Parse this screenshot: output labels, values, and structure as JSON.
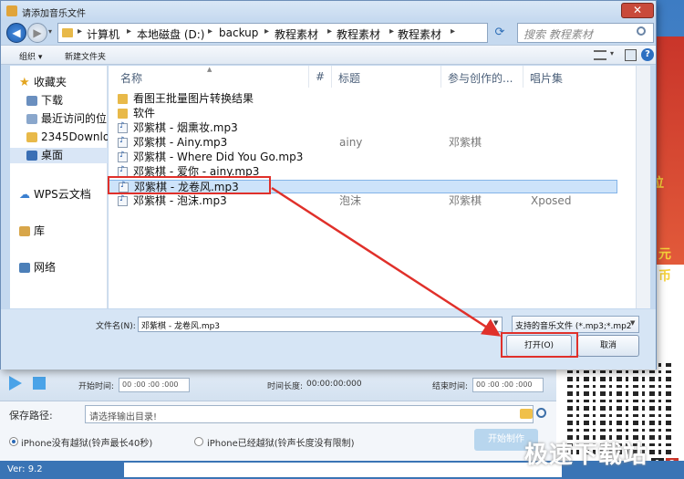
{
  "dialog": {
    "title": "请添加音乐文件",
    "close_label": "✕",
    "breadcrumbs": [
      "计算机",
      "本地磁盘 (D:)",
      "backup",
      "教程素材",
      "教程素材",
      "教程素材"
    ],
    "search_placeholder": "搜索 教程素材",
    "toolbar": {
      "organize": "组织 ▾",
      "new_folder": "新建文件夹"
    },
    "nav_pane": {
      "favorites": "收藏夹",
      "items": [
        "下载",
        "最近访问的位",
        "2345Downlo",
        "桌面"
      ],
      "wps": "WPS云文档",
      "library": "库",
      "network": "网络"
    },
    "columns": [
      "名称",
      "#",
      "标题",
      "参与创作的...",
      "唱片集"
    ],
    "files": [
      {
        "name": "看图王批量图片转换结果",
        "type": "folder",
        "track": "",
        "title": "",
        "artist": "",
        "album": ""
      },
      {
        "name": "软件",
        "type": "folder",
        "track": "",
        "title": "",
        "artist": "",
        "album": ""
      },
      {
        "name": "邓紫棋 - 烟熏妆.mp3",
        "type": "audio",
        "track": "",
        "title": "",
        "artist": "",
        "album": ""
      },
      {
        "name": "邓紫棋 - Ainy.mp3",
        "type": "audio",
        "track": "",
        "title": "ainy",
        "artist": "邓紫棋",
        "album": ""
      },
      {
        "name": "邓紫棋 - Where Did You Go.mp3",
        "type": "audio",
        "track": "",
        "title": "",
        "artist": "",
        "album": ""
      },
      {
        "name": "邓紫棋 - 爱你 - ainy.mp3",
        "type": "audio",
        "track": "",
        "title": "",
        "artist": "",
        "album": ""
      },
      {
        "name": "邓紫棋 - 龙卷风.mp3",
        "type": "audio",
        "track": "",
        "title": "",
        "artist": "",
        "album": "",
        "selected": true
      },
      {
        "name": "邓紫棋 - 泡沫.mp3",
        "type": "audio",
        "track": "",
        "title": "泡沫",
        "artist": "邓紫棋",
        "album": "Xposed"
      }
    ],
    "filename_label": "文件名(N):",
    "filename_value": "邓紫棋 - 龙卷风.mp3",
    "filter_value": "支持的音乐文件 (*.mp3;*.mp2",
    "open_label": "打开(O)",
    "cancel_label": "取消"
  },
  "app": {
    "start_time_label": "开始时间:",
    "start_time": "00 :00 :00 :000",
    "duration_label": "时间长度:",
    "duration": "00:00:00:000",
    "end_time_label": "结束时间:",
    "end_time": "00 :00 :00 :000",
    "save_path_label": "保存路径:",
    "save_path_placeholder": "请选择输出目录!",
    "radio_jailbroken_no": "iPhone没有越狱(铃声最长40秒)",
    "radio_jailbroken_yes": "iPhone已经越狱(铃声长度没有限制)",
    "start_button": "开始制作",
    "version": "Ver: 9.2",
    "ad_chars": [
      "位",
      "元",
      "币"
    ],
    "pages": [
      "1",
      "2"
    ],
    "watermark": "极速下载站"
  },
  "colors": {
    "annotation": "#e0302a",
    "selection": "#cde3fa",
    "accent": "#2a69b6"
  }
}
